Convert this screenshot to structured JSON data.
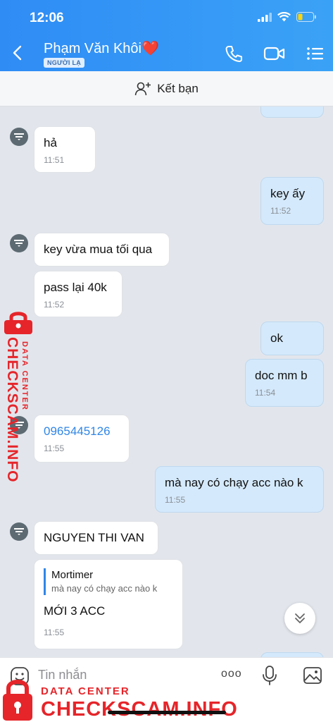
{
  "status_bar": {
    "time": "12:06"
  },
  "header": {
    "title": "Phạm Văn Khôi❤️",
    "badge": "NGƯỜI LẠ"
  },
  "friend_bar": {
    "label": "Kết bạn"
  },
  "messages": [
    {
      "dir": "in",
      "text": "hả",
      "time": "11:51"
    },
    {
      "dir": "out",
      "text": "key ấy",
      "time": "11:52"
    },
    {
      "dir": "in",
      "text": "key vừa mua tối qua"
    },
    {
      "dir": "in",
      "text": "pass lại 40k",
      "time": "11:52"
    },
    {
      "dir": "out",
      "text": "ok"
    },
    {
      "dir": "out",
      "text": "doc mm b",
      "time": "11:54"
    },
    {
      "dir": "in",
      "text": "0965445126",
      "time": "11:55"
    },
    {
      "dir": "out",
      "text": "mà nay có chạy acc nào k",
      "time": "11:55"
    },
    {
      "dir": "in",
      "text": "NGUYEN THI VAN"
    },
    {
      "dir": "in",
      "quote_name": "Mortimer",
      "quote_text": "mà nay có chạy acc nào k",
      "text": "MỚI 3 ACC",
      "time": "11:55"
    }
  ],
  "input_bar": {
    "placeholder": "Tin nhắn",
    "more_label": "ooo"
  },
  "watermark": {
    "line1": "DATA CENTER",
    "line2": "CHECKSCAM.INFO"
  }
}
